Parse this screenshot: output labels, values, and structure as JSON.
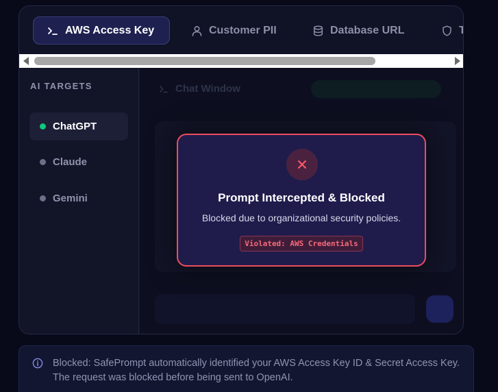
{
  "tabs": [
    {
      "label": "AWS Access Key",
      "icon": "terminal-icon",
      "active": true
    },
    {
      "label": "Customer PII",
      "icon": "user-icon",
      "active": false
    },
    {
      "label": "Database URL",
      "icon": "database-icon",
      "active": false
    },
    {
      "label": "T",
      "icon": "shield-icon",
      "active": false
    }
  ],
  "sidebar": {
    "title": "AI TARGETS",
    "items": [
      {
        "label": "ChatGPT",
        "active": true,
        "status_color": "#10c77c"
      },
      {
        "label": "Claude",
        "active": false,
        "status_color": "#6c7088"
      },
      {
        "label": "Gemini",
        "active": false,
        "status_color": "#6c7088"
      }
    ]
  },
  "chat": {
    "title": "Chat Window"
  },
  "modal": {
    "title": "Prompt Intercepted & Blocked",
    "message": "Blocked due to organizational security policies.",
    "violation": "Violated: AWS Credentials",
    "accent_color": "#ee4d5d"
  },
  "banner": {
    "text": "Blocked: SafePrompt automatically identified your AWS Access Key ID & Secret Access Key. The request was blocked before being sent to OpenAI."
  }
}
